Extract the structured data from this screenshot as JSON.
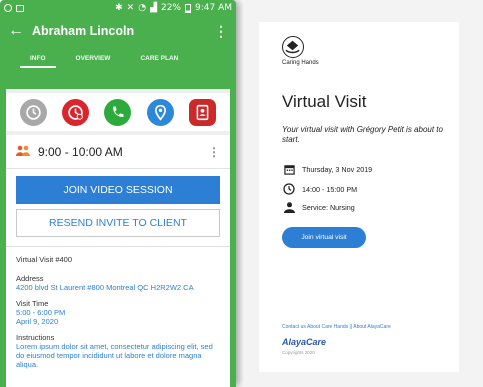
{
  "status_bar": {
    "battery_percent": "22%",
    "time": "9:47 AM"
  },
  "app_bar": {
    "title": "Abraham Lincoln",
    "back_icon": "arrow-left-icon",
    "menu_icon": "more-vert-icon"
  },
  "tabs": [
    {
      "label": "INFO",
      "active": true
    },
    {
      "label": "OVERVIEW",
      "active": false
    },
    {
      "label": "CARE PLAN",
      "active": false
    }
  ],
  "action_icons": [
    {
      "name": "clock-icon",
      "color": "#a8a8a8"
    },
    {
      "name": "clock-off-icon",
      "color": "#d9262e"
    },
    {
      "name": "phone-icon",
      "color": "#2cab3c"
    },
    {
      "name": "location-icon",
      "color": "#2c88d9"
    },
    {
      "name": "contacts-icon",
      "color": "#cc2a2a"
    }
  ],
  "visit": {
    "time_range": "9:00 - 10:00 AM",
    "join_button": "JOIN VIDEO SESSION",
    "resend_button": "RESEND INVITE TO CLIENT",
    "title": "Virtual Visit #400",
    "address_label": "Address",
    "address": "4200 blvd St Laurent #800 Montreal QC H2R2W2 CA",
    "visit_time_label": "Visit Time",
    "visit_time": "5:00 - 6:00 PM",
    "visit_date": "April 9, 2020",
    "instructions_label": "Instructions",
    "instructions": "Lorem ipsum dolor sit amet, consectetur adipiscing elit, sed do eiusmod tempor incididunt ut labore et dolore magna aliqua."
  },
  "email": {
    "brand": "Caring Hands",
    "heading": "Virtual Visit",
    "message": "Your virtual visit with Grégory Petit is about to start.",
    "date": "Thursday, 3 Nov 2019",
    "time": "14:00 - 15:00 PM",
    "service": "Service: Nursing",
    "join_button": "Join virtual visit",
    "footer_links": "Contact us  About Care Hands || About AlayaCare",
    "footer_brand": "AlayaCare",
    "copyright": "Copyrights 2020"
  },
  "colors": {
    "brand_green": "#4ab04d",
    "primary_blue": "#2d7fd6",
    "accent_orange": "#e7592a"
  }
}
